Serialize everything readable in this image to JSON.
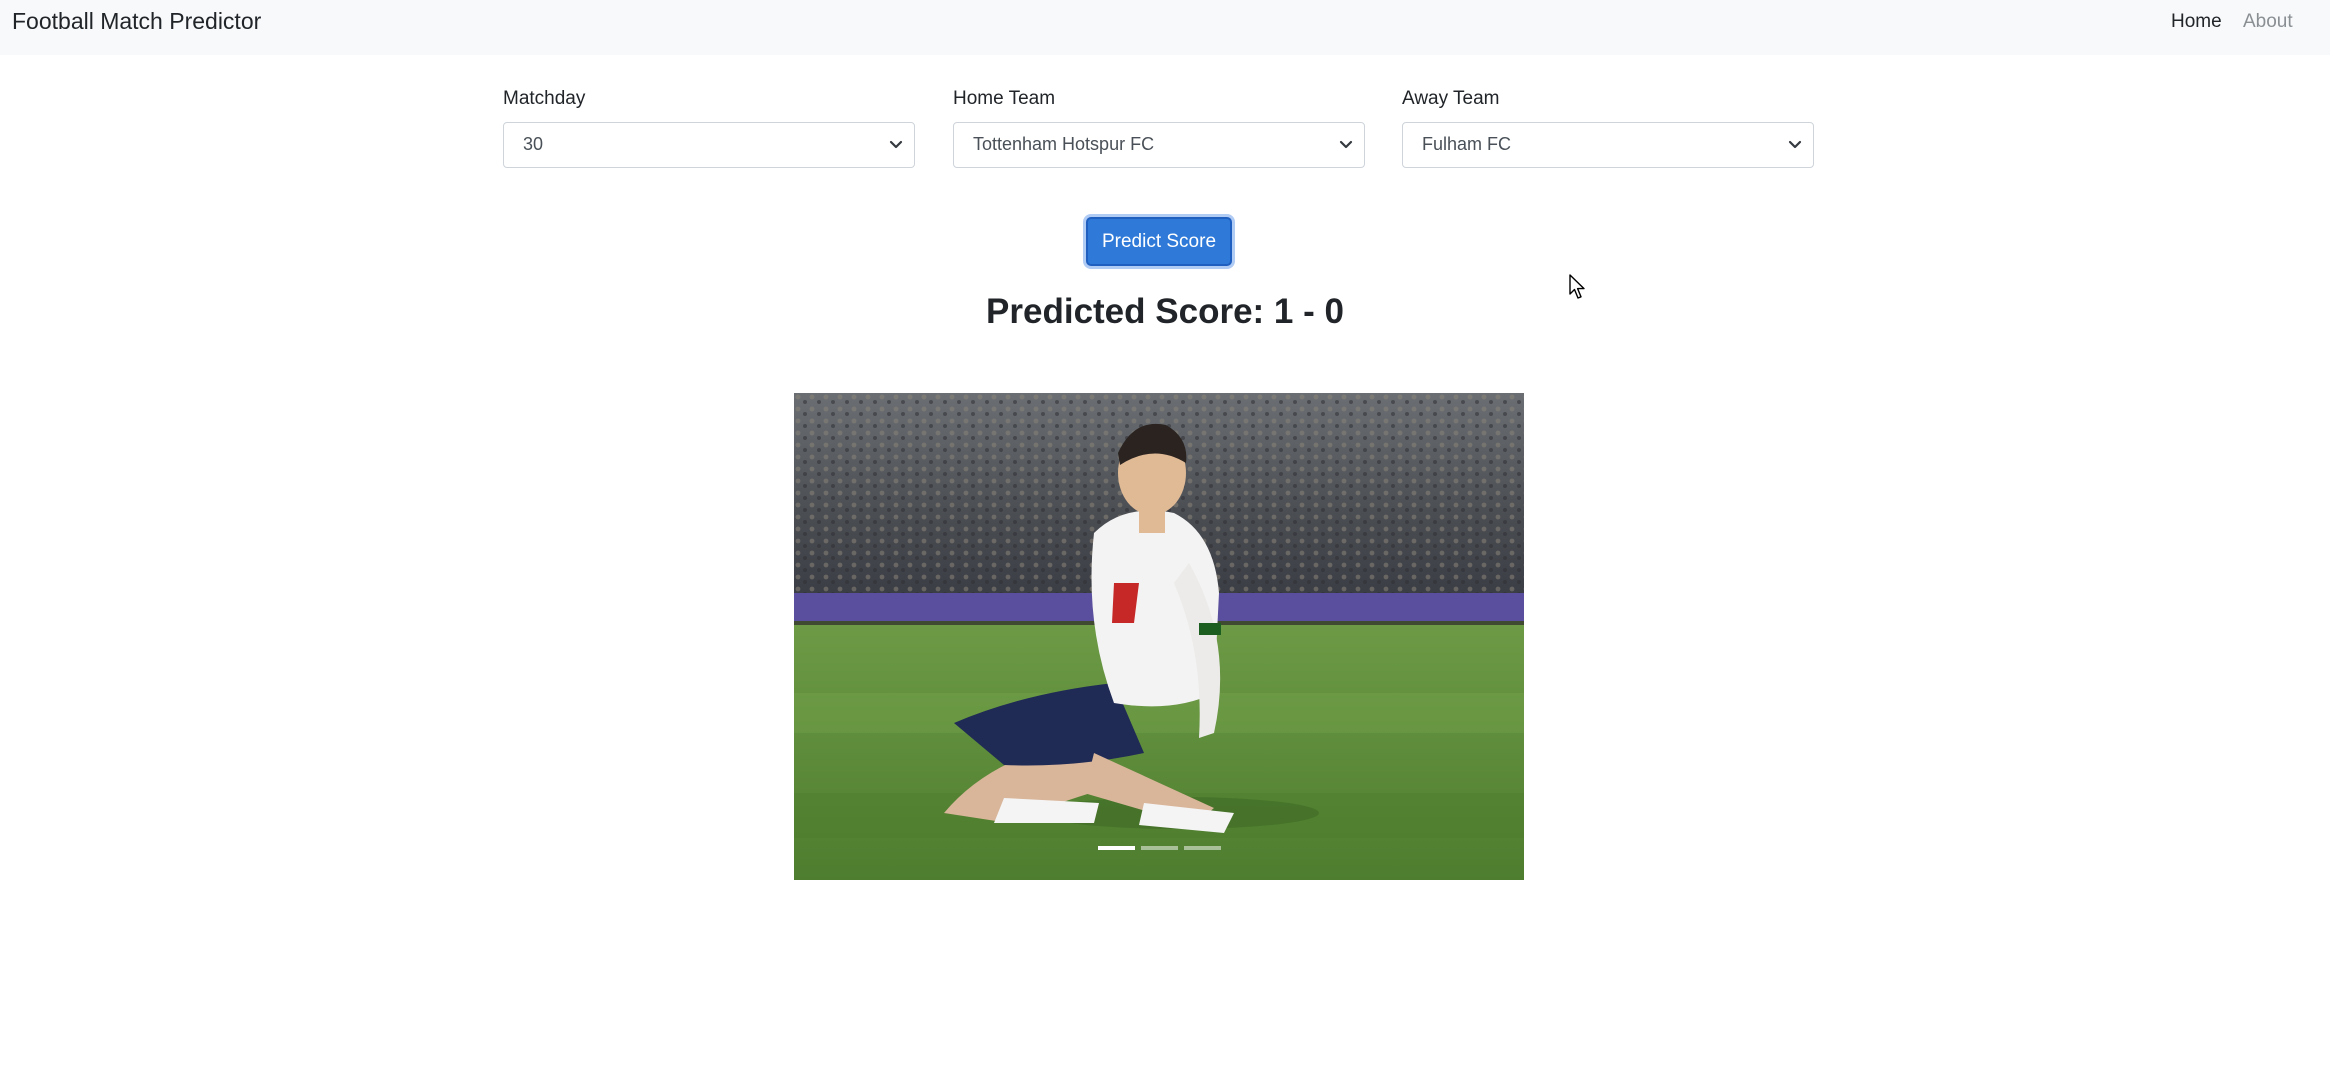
{
  "navbar": {
    "brand": "Football Match Predictor",
    "links": [
      {
        "label": "Home",
        "active": true
      },
      {
        "label": "About",
        "active": false
      }
    ]
  },
  "form": {
    "matchday": {
      "label": "Matchday",
      "value": "30"
    },
    "home_team": {
      "label": "Home Team",
      "value": "Tottenham Hotspur FC"
    },
    "away_team": {
      "label": "Away Team",
      "value": "Fulham FC"
    }
  },
  "predict_button": {
    "label": "Predict Score"
  },
  "result": {
    "text": "Predicted Score: 1 - 0"
  },
  "carousel": {
    "slides": 3,
    "active_index": 0,
    "image_description_icon": "player-celebration-photo"
  },
  "colors": {
    "primary": "#2f7ad8",
    "navbar_bg": "#f8f9fa",
    "pitch_green": "#5f8f3a"
  }
}
